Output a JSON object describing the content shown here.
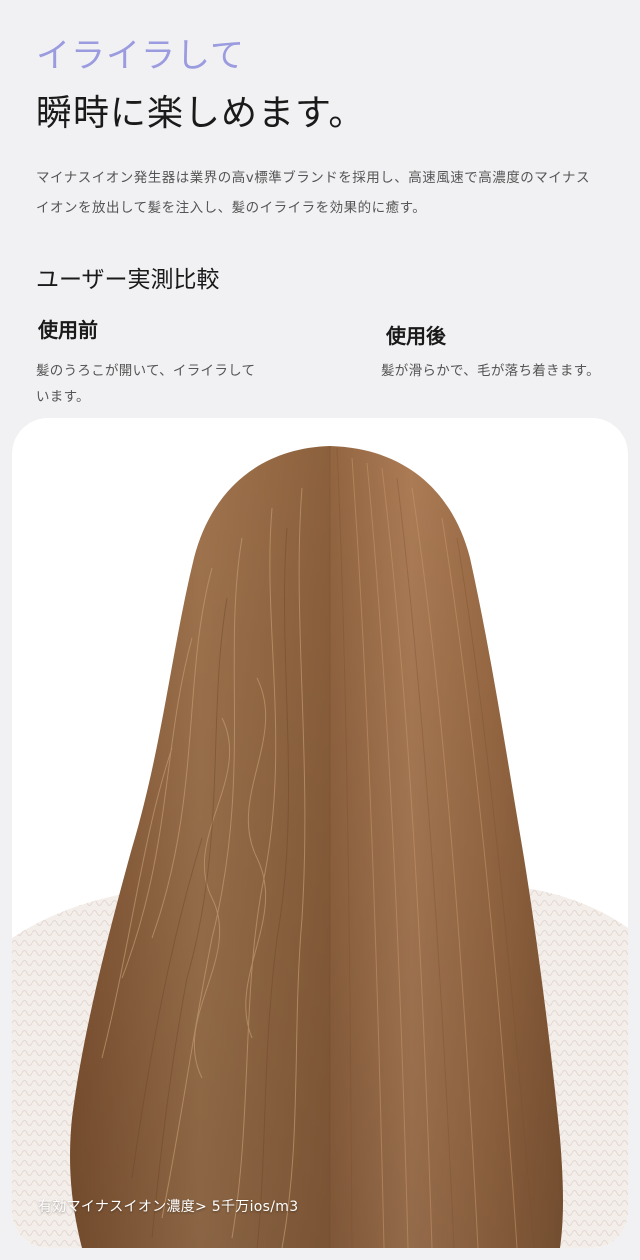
{
  "hero": {
    "headline_line1": "イライラして",
    "headline_line2": "瞬時に楽しめます。",
    "description": "マイナスイオン発生器は業界の高v標準ブランドを採用し、高速風速で高濃度のマイナスイオンを放出して髪を注入し、髪のイライラを効果的に癒す。"
  },
  "comparison": {
    "section_title": "ユーザー実測比較",
    "before": {
      "title": "使用前",
      "text": "髪のうろこが開いて、イライラしています。"
    },
    "after": {
      "title": "使用後",
      "text": "髪が滑らかで、毛が落ち着きます。"
    }
  },
  "photo": {
    "ion_label": "有効マイナスイオン濃度> 5千万ios/m3"
  },
  "colors": {
    "page_background": "#f1f1f3",
    "headline_accent": "#9b9be0",
    "hair_brown": "#a07048"
  }
}
